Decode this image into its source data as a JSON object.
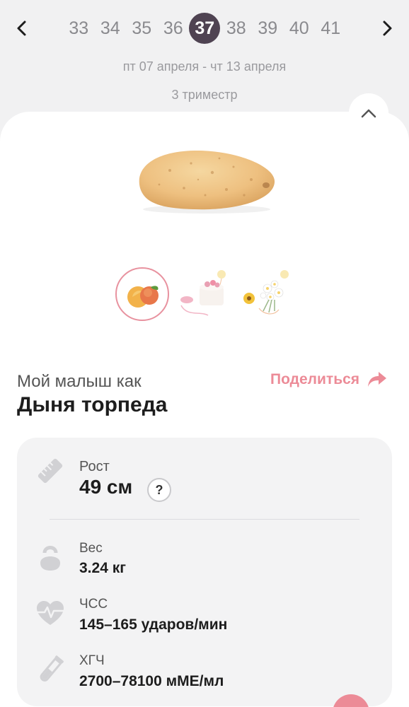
{
  "weeks": {
    "items": [
      "33",
      "34",
      "35",
      "36",
      "37",
      "38",
      "39",
      "40",
      "41"
    ],
    "active": "37"
  },
  "date_range": "пт 07 апреля - чт 13 апреля",
  "trimester": "3 триместр",
  "comparison": {
    "subtitle": "Мой малыш как",
    "title": "Дыня торпеда",
    "share_label": "Поделиться"
  },
  "stats": {
    "growth": {
      "label": "Рост",
      "value": "49 см",
      "help": "?"
    },
    "weight": {
      "label": "Вес",
      "value": "3.24 кг"
    },
    "heart_rate": {
      "label": "ЧСС",
      "value": "145–165 ударов/мин"
    },
    "hcg": {
      "label": "ХГЧ",
      "value": "2700–78100 мМЕ/мл"
    }
  },
  "colors": {
    "accent": "#ec8b97",
    "active_week": "#4f4352",
    "background": "#f1f1f2",
    "card": "#f3f3f4"
  },
  "icons": {
    "prev": "chevron-left-icon",
    "next": "chevron-right-icon",
    "collapse": "chevron-up-icon",
    "share": "share-arrow-icon",
    "growth": "ruler-icon",
    "weight": "kettlebell-icon",
    "heart_rate": "heart-pulse-icon",
    "hcg": "test-tube-icon"
  }
}
